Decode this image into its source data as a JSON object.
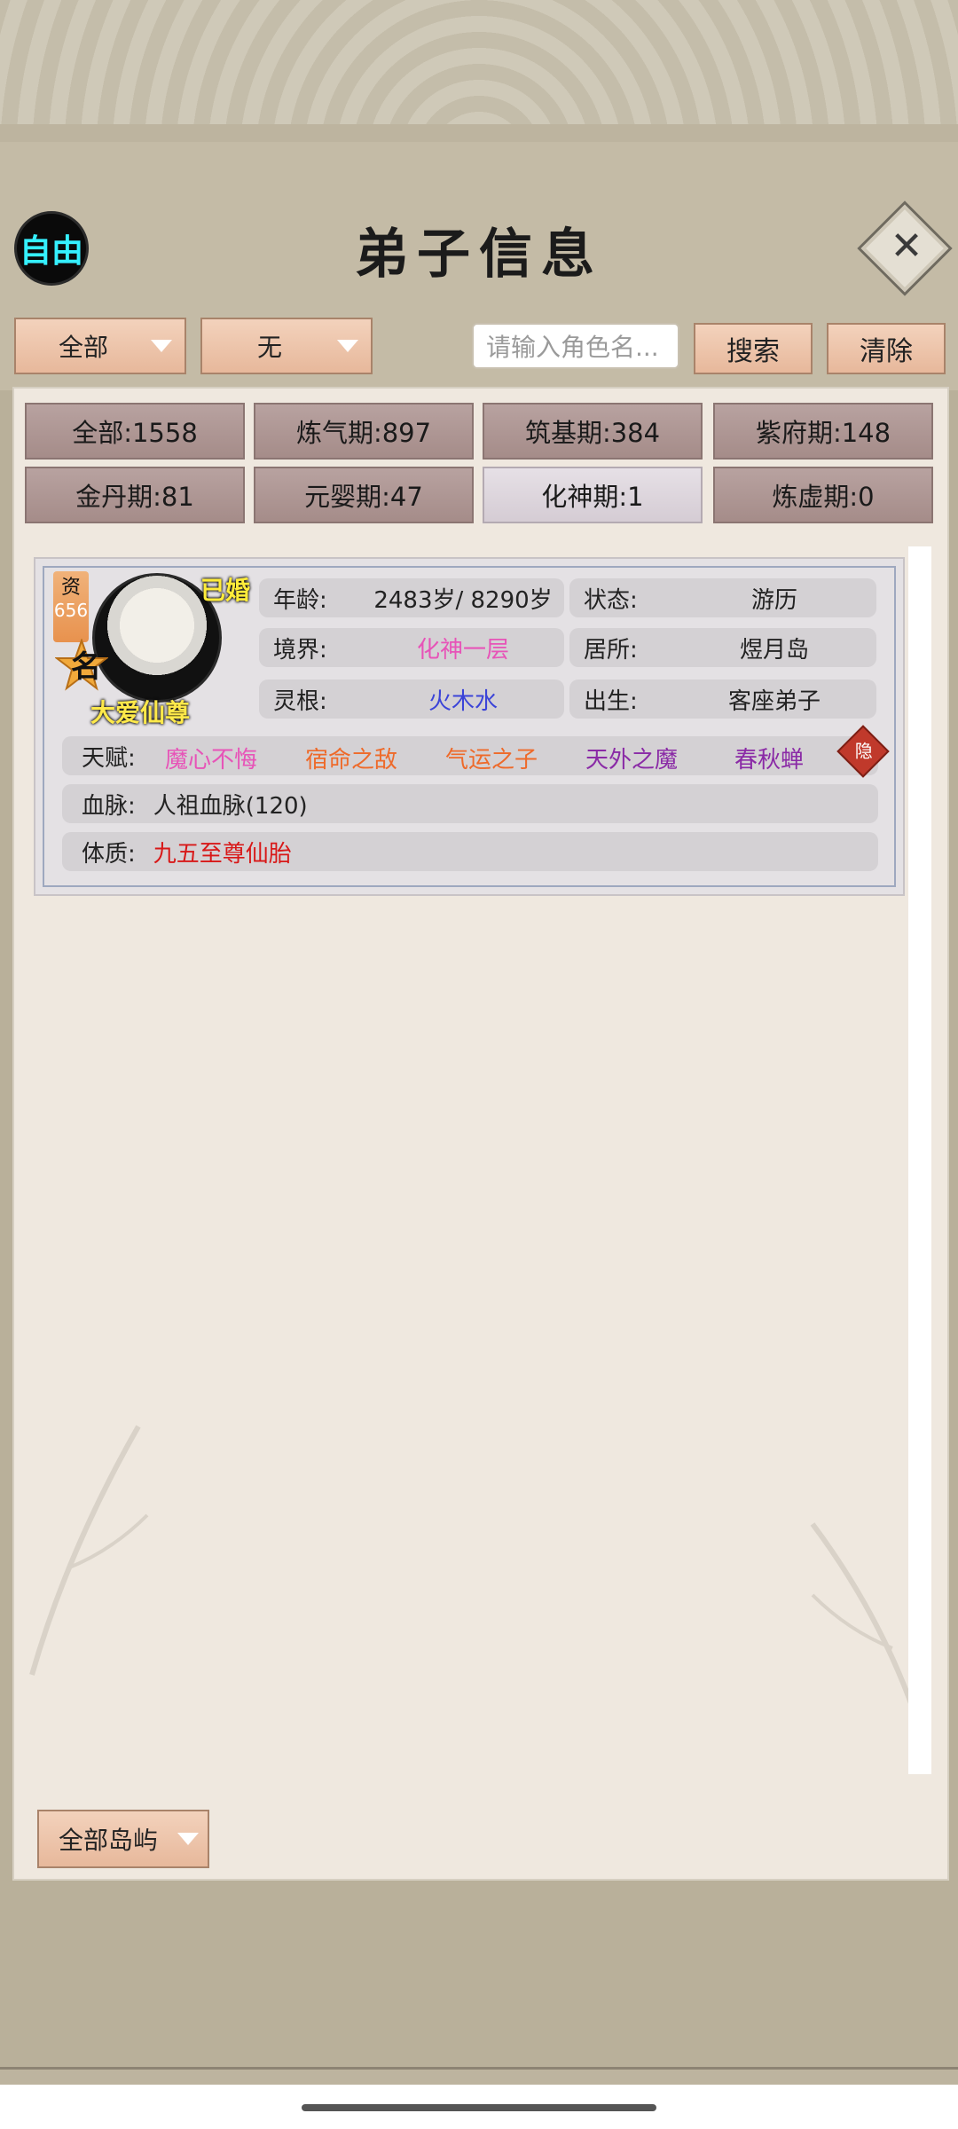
{
  "header": {
    "mode_badge": "自由",
    "title": "弟子信息",
    "close_icon": "close-x"
  },
  "filters": {
    "category": "全部",
    "sub_filter": "无",
    "search_placeholder": "请输入角色名...",
    "search_label": "搜索",
    "clear_label": "清除"
  },
  "stats": [
    "全部:1558",
    "炼气期:897",
    "筑基期:384",
    "紫府期:148",
    "金丹期:81",
    "元婴期:47",
    "化神期:1",
    "炼虚期:0"
  ],
  "disciple": {
    "aptitude_label": "资",
    "aptitude_value": "656",
    "married": "已婚",
    "fame": "名",
    "name": "大爱仙尊",
    "age_label": "年龄:",
    "age_value": "2483岁/ 8290岁",
    "status_label": "状态:",
    "status_value": "游历",
    "realm_label": "境界:",
    "realm_value": "化神一层",
    "residence_label": "居所:",
    "residence_value": "煜月岛",
    "root_label": "灵根:",
    "root_value": "火木水",
    "origin_label": "出生:",
    "origin_value": "客座弟子",
    "talent_label": "天赋:",
    "talents": [
      "魔心不悔",
      "宿命之敌",
      "气运之子",
      "天外之魔",
      "春秋蝉"
    ],
    "hide_label": "隐",
    "bloodline_label": "血脉:",
    "bloodline_value": "人祖血脉(120)",
    "physique_label": "体质:",
    "physique_value": "九五至尊仙胎"
  },
  "footer": {
    "island_filter": "全部岛屿"
  },
  "colors": {
    "mode_badge_text": "#35f0ff",
    "realm": "#e754b8",
    "root": "#3b44d8",
    "talent_pink": "#e754b8",
    "talent_orange": "#ee6a2a",
    "talent_purple": "#8a2aa6",
    "physique": "#d81818",
    "name_yellow": "#ffe94a"
  }
}
